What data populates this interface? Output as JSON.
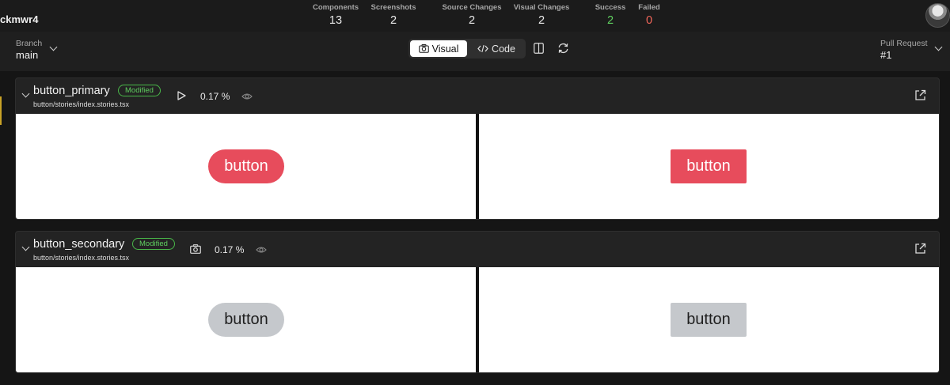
{
  "header": {
    "project": "ckmwr4",
    "stats": [
      {
        "label": "Components",
        "value": "13"
      },
      {
        "label": "Screenshots",
        "value": "2"
      },
      {
        "label": "Source Changes",
        "value": "2"
      },
      {
        "label": "Visual Changes",
        "value": "2"
      },
      {
        "label": "Success",
        "value": "2"
      },
      {
        "label": "Failed",
        "value": "0"
      }
    ],
    "colors": {
      "success": "#5fcf5f",
      "failed": "#f2665a"
    }
  },
  "controls": {
    "branch_label": "Branch",
    "branch_value": "main",
    "view_modes": [
      "Visual",
      "Code"
    ],
    "active_view": "Visual",
    "pr_label": "Pull Request",
    "pr_value": "#1"
  },
  "stories": [
    {
      "name": "button_primary",
      "badge": "Modified",
      "path": "button/stories/index.stories.tsx",
      "diff": "0.17 %",
      "mode_icon": "play-icon",
      "sample_text": "button",
      "sample_color": "#e74c5c"
    },
    {
      "name": "button_secondary",
      "badge": "Modified",
      "path": "button/stories/index.stories.tsx",
      "diff": "0.17 %",
      "mode_icon": "camera-icon",
      "sample_text": "button",
      "sample_color": "#c5c8cc"
    }
  ]
}
